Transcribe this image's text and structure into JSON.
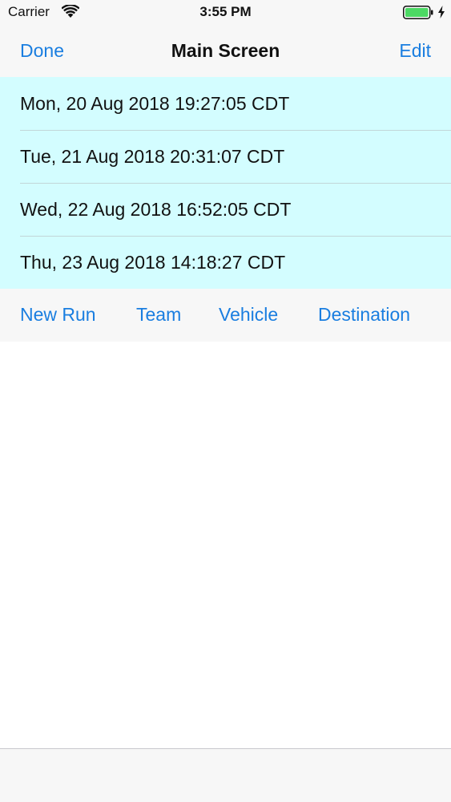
{
  "status_bar": {
    "carrier": "Carrier",
    "time": "3:55 PM",
    "battery_color": "#4cd964"
  },
  "nav": {
    "left_button": "Done",
    "title": "Main Screen",
    "right_button": "Edit"
  },
  "runs": [
    "Mon, 20 Aug 2018 19:27:05 CDT",
    "Tue, 21 Aug 2018 20:31:07 CDT",
    "Wed, 22 Aug 2018 16:52:05 CDT",
    "Thu, 23 Aug 2018 14:18:27 CDT"
  ],
  "toolbar": {
    "new_run": "New Run",
    "team": "Team",
    "vehicle": "Vehicle",
    "destination": "Destination"
  },
  "colors": {
    "accent": "#1a7ee0",
    "list_background": "#d3fdff",
    "bar_background": "#f7f7f7"
  }
}
